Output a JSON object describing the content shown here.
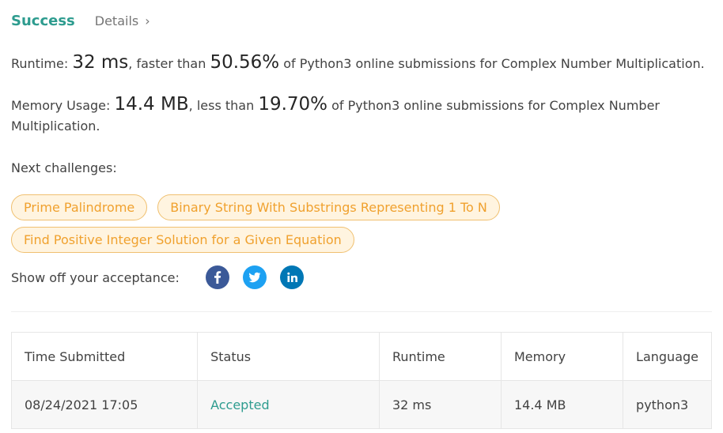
{
  "header": {
    "status": "Success",
    "details_label": "Details"
  },
  "runtime": {
    "label": "Runtime: ",
    "value": "32 ms",
    "mid": ", faster than ",
    "percent": "50.56%",
    "suffix": " of Python3 online submissions for Complex Number Multiplication."
  },
  "memory": {
    "label": "Memory Usage: ",
    "value": "14.4 MB",
    "mid": ", less than ",
    "percent": "19.70%",
    "suffix": " of Python3 online submissions for Complex Number Multiplication."
  },
  "next": {
    "label": "Next challenges:",
    "challenges": [
      "Prime Palindrome",
      "Binary String With Substrings Representing 1 To N",
      "Find Positive Integer Solution for a Given Equation"
    ]
  },
  "share": {
    "label": "Show off your acceptance:",
    "icons": [
      {
        "name": "facebook-icon",
        "color": "#3b5998"
      },
      {
        "name": "twitter-icon",
        "color": "#1da1f2"
      },
      {
        "name": "linkedin-icon",
        "color": "#0077b5"
      }
    ]
  },
  "table": {
    "headers": [
      "Time Submitted",
      "Status",
      "Runtime",
      "Memory",
      "Language"
    ],
    "rows": [
      [
        "08/24/2021 17:05",
        "Accepted",
        "32 ms",
        "14.4 MB",
        "python3"
      ]
    ]
  }
}
